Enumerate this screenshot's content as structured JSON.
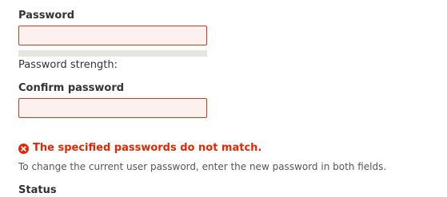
{
  "password": {
    "label": "Password",
    "value": "",
    "placeholder": "",
    "strength_label": "Password strength:",
    "strength_fraction": 0
  },
  "confirm_password": {
    "label": "Confirm password",
    "value": "",
    "placeholder": ""
  },
  "error": {
    "icon": "error-circle-x-icon",
    "message": "The specified passwords do not match."
  },
  "description": "To change the current user password, enter the new password in both fields.",
  "next_field": {
    "label": "Status"
  },
  "colors": {
    "error_text": "#e32700",
    "input_border_error": "#cc3b1f",
    "input_background_error": "#fdf1ef",
    "strength_track": "#e6e6e1"
  }
}
